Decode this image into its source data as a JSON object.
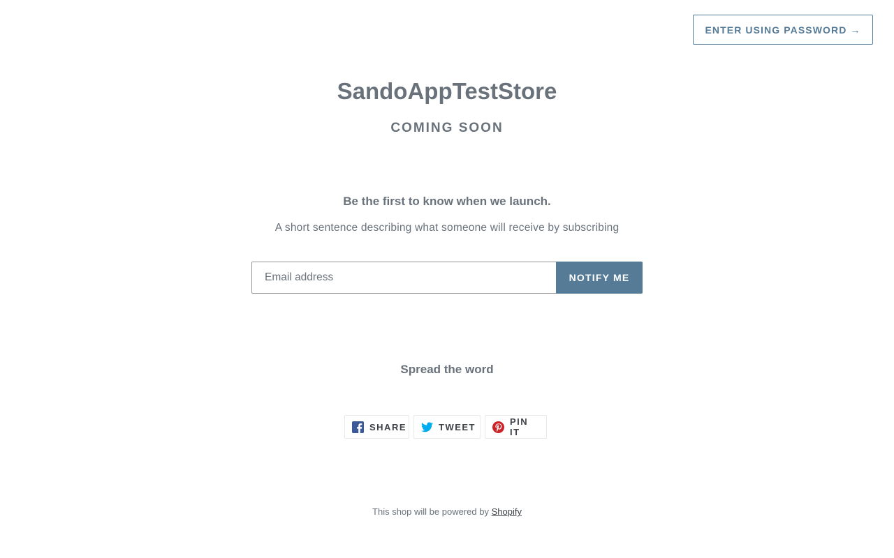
{
  "header": {
    "password_button_label": "Enter using password →"
  },
  "hero": {
    "store_name": "SandoAppTestStore",
    "tagline": "Coming Soon"
  },
  "newsletter": {
    "heading": "Be the first to know when we launch.",
    "description": "A short sentence describing what someone will receive by subscribing",
    "email_placeholder": "Email address",
    "email_value": "",
    "submit_label": "Notify me"
  },
  "social": {
    "heading": "Spread the word",
    "buttons": [
      {
        "label": "Share",
        "icon": "facebook-icon",
        "color": "#3b5998"
      },
      {
        "label": "Tweet",
        "icon": "twitter-icon",
        "color": "#00aced"
      },
      {
        "label": "Pin it",
        "icon": "pinterest-icon",
        "color": "#cb2127"
      }
    ]
  },
  "footer": {
    "text": "This shop will be powered by",
    "link_label": "Shopify"
  },
  "colors": {
    "accent": "#557b97",
    "text": "#69727b",
    "dark_text": "#3d4246"
  }
}
